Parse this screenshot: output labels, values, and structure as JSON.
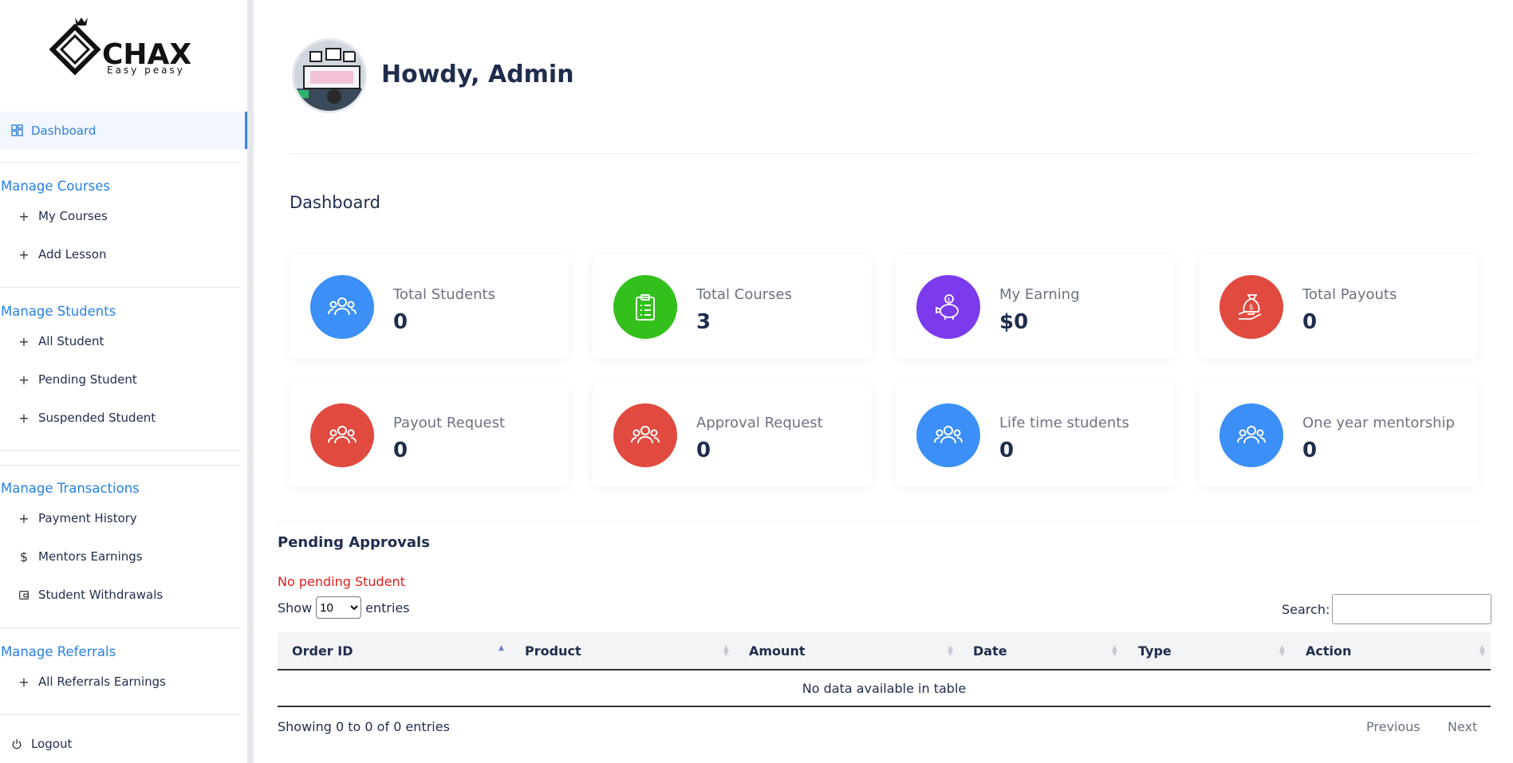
{
  "brand": {
    "name": "CHAX",
    "tagline": "Easy peasy"
  },
  "sidebar": {
    "dashboard_label": "Dashboard",
    "groups": [
      {
        "title": "Manage Courses",
        "items": [
          {
            "label": "My Courses",
            "icon": "plus-icon"
          },
          {
            "label": "Add Lesson",
            "icon": "plus-icon"
          }
        ]
      },
      {
        "title": "Manage Students",
        "items": [
          {
            "label": "All Student",
            "icon": "plus-icon"
          },
          {
            "label": "Pending Student",
            "icon": "plus-icon"
          },
          {
            "label": "Suspended Student",
            "icon": "plus-icon"
          }
        ]
      },
      {
        "title": "Manage Transactions",
        "items": [
          {
            "label": "Payment History",
            "icon": "plus-icon"
          },
          {
            "label": "Mentors Earnings",
            "icon": "dollar-icon"
          },
          {
            "label": "Student Withdrawals",
            "icon": "wallet-icon"
          }
        ]
      },
      {
        "title": "Manage Referrals",
        "items": [
          {
            "label": "All Referrals Earnings",
            "icon": "plus-icon"
          }
        ]
      }
    ],
    "logout_label": "Logout"
  },
  "header": {
    "greeting": "Howdy, Admin"
  },
  "dashboard": {
    "title": "Dashboard",
    "cards": [
      {
        "label": "Total Students",
        "value": "0",
        "color": "#3b8ff6",
        "icon": "users-icon"
      },
      {
        "label": "Total Courses",
        "value": "3",
        "color": "#33c01c",
        "icon": "clipboard-icon"
      },
      {
        "label": "My Earning",
        "value": "$0",
        "color": "#7c3aed",
        "icon": "piggy-bank-icon"
      },
      {
        "label": "Total Payouts",
        "value": "0",
        "color": "#e04a3f",
        "icon": "money-bag-icon"
      },
      {
        "label": "Payout Request",
        "value": "0",
        "color": "#e04a3f",
        "icon": "users-icon"
      },
      {
        "label": "Approval Request",
        "value": "0",
        "color": "#e04a3f",
        "icon": "users-icon"
      },
      {
        "label": "Life time students",
        "value": "0",
        "color": "#3b8ff6",
        "icon": "users-icon"
      },
      {
        "label": "One year mentorship",
        "value": "0",
        "color": "#3b8ff6",
        "icon": "users-icon"
      }
    ]
  },
  "pending": {
    "title": "Pending Approvals",
    "empty_notice": "No pending Student",
    "show_label": "Show",
    "entries_label": "entries",
    "page_size": "10",
    "search_label": "Search:",
    "columns": [
      "Order ID",
      "Product",
      "Amount",
      "Date",
      "Type",
      "Action"
    ],
    "empty_table": "No data available in table",
    "info": "Showing 0 to 0 of 0 entries",
    "prev": "Previous",
    "next": "Next"
  }
}
